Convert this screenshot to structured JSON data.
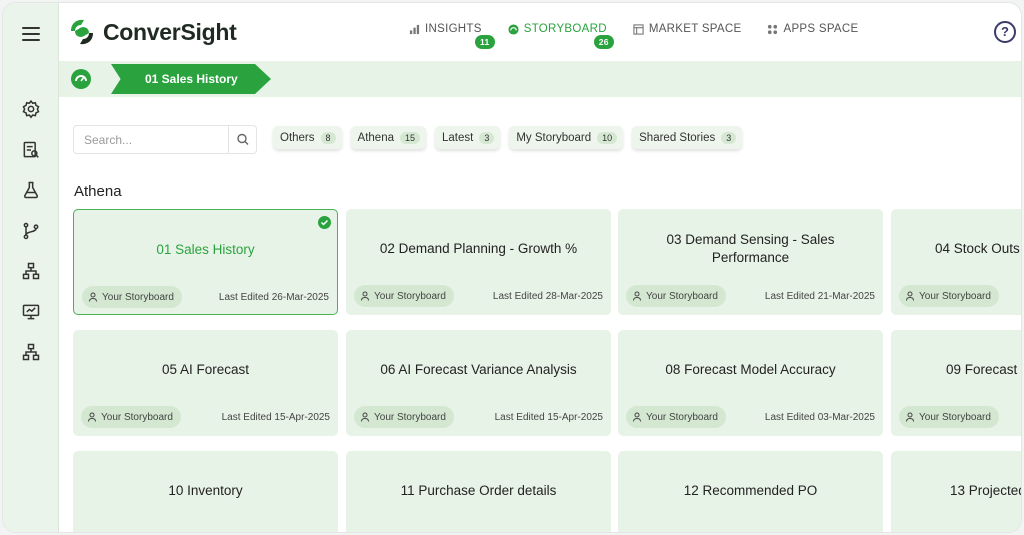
{
  "app": {
    "brand": "ConverSight",
    "accent": "#2aa33f"
  },
  "nav": {
    "items": [
      {
        "label": "INSIGHTS",
        "badge": "11",
        "icon": "bar-chart-icon"
      },
      {
        "label": "STORYBOARD",
        "badge": "26",
        "icon": "storyboard-icon",
        "active": true
      },
      {
        "label": "MARKET SPACE",
        "icon": "market-icon"
      },
      {
        "label": "APPS SPACE",
        "icon": "apps-grid-icon"
      }
    ],
    "help": "?"
  },
  "breadcrumb": {
    "current": "01 Sales History"
  },
  "search": {
    "placeholder": "Search..."
  },
  "filters": [
    {
      "label": "Others",
      "count": "8"
    },
    {
      "label": "Athena",
      "count": "15"
    },
    {
      "label": "Latest",
      "count": "3"
    },
    {
      "label": "My Storyboard",
      "count": "10"
    },
    {
      "label": "Shared Stories",
      "count": "3"
    }
  ],
  "section": {
    "title": "Athena"
  },
  "cards": [
    {
      "title": "01 Sales History",
      "owner": "Your Storyboard",
      "edited": "Last Edited 26-Mar-2025",
      "selected": true
    },
    {
      "title": "02 Demand Planning - Growth %",
      "owner": "Your Storyboard",
      "edited": "Last Edited 28-Mar-2025"
    },
    {
      "title": "03 Demand Sensing - Sales Performance",
      "owner": "Your Storyboard",
      "edited": "Last Edited 21-Mar-2025"
    },
    {
      "title": "04 Stock Outs",
      "owner": "Your Storyboard",
      "edited": ""
    },
    {
      "title": "05 AI Forecast",
      "owner": "Your Storyboard",
      "edited": "Last Edited 15-Apr-2025"
    },
    {
      "title": "06 AI Forecast Variance Analysis",
      "owner": "Your Storyboard",
      "edited": "Last Edited 15-Apr-2025"
    },
    {
      "title": "08 Forecast Model Accuracy",
      "owner": "Your Storyboard",
      "edited": "Last Edited 03-Mar-2025"
    },
    {
      "title": "09 Forecast",
      "owner": "Your Storyboard",
      "edited": ""
    },
    {
      "title": "10 Inventory",
      "owner": "",
      "edited": ""
    },
    {
      "title": "11 Purchase Order details",
      "owner": "",
      "edited": ""
    },
    {
      "title": "12 Recommended PO",
      "owner": "",
      "edited": ""
    },
    {
      "title": "13 Projected",
      "owner": "",
      "edited": ""
    }
  ]
}
